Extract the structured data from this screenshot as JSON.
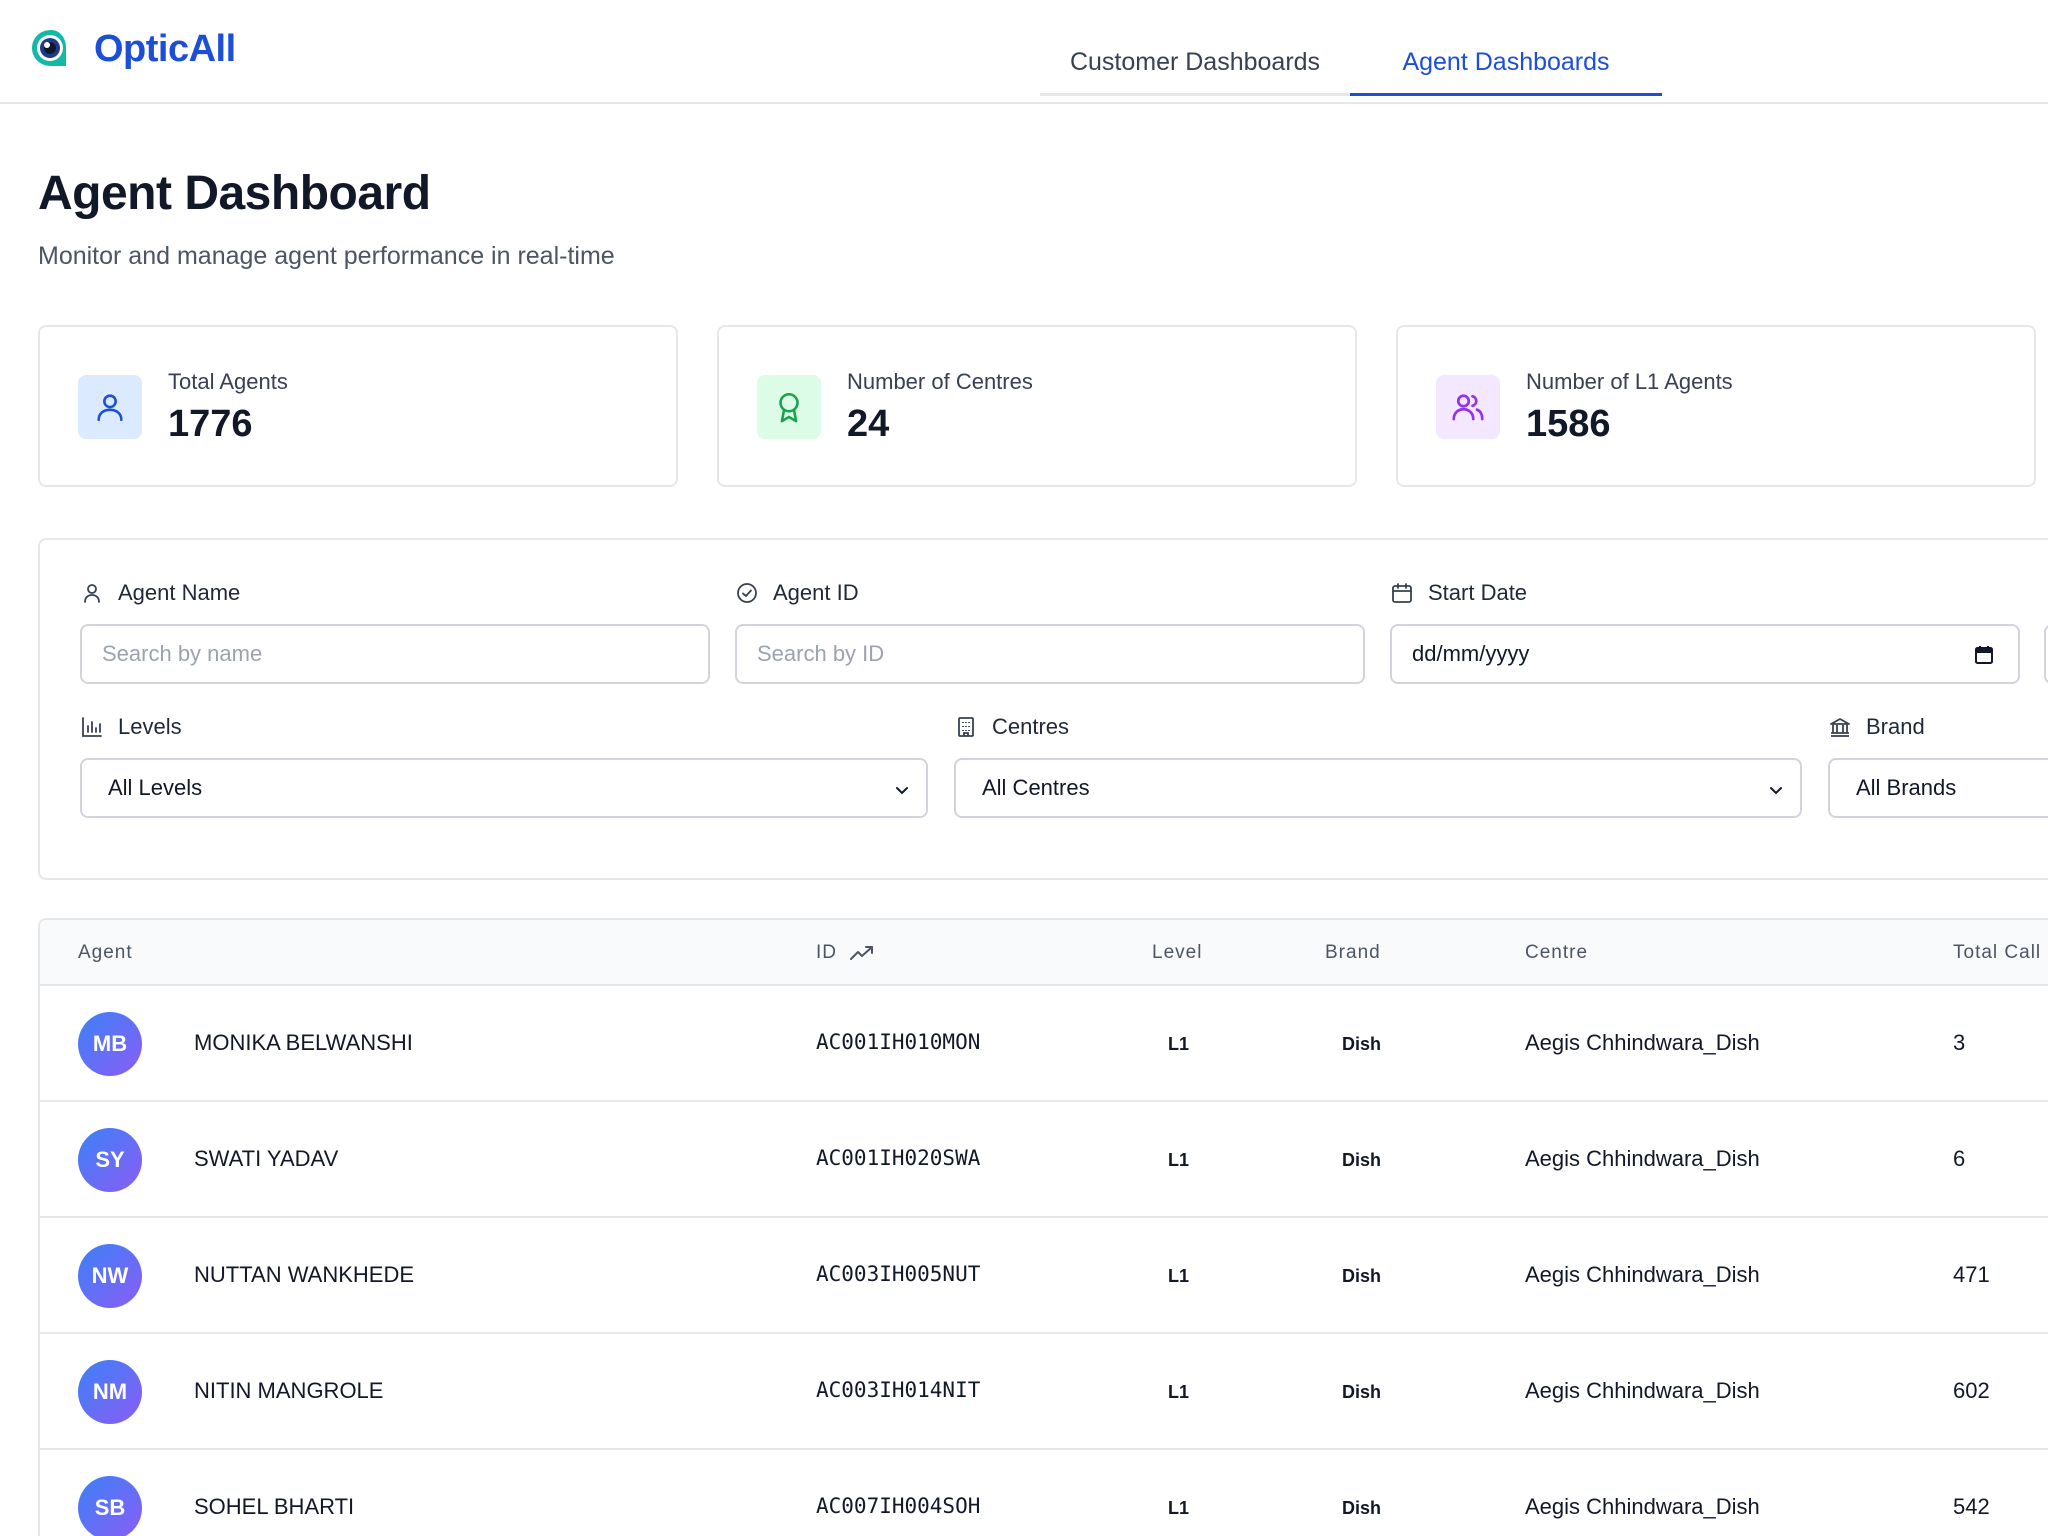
{
  "app": {
    "name": "OpticAll",
    "brand_color": "#1d4ed8"
  },
  "nav": {
    "tabs": [
      {
        "label": "Customer Dashboards",
        "active": false
      },
      {
        "label": "Agent Dashboards",
        "active": true
      }
    ]
  },
  "page": {
    "title": "Agent Dashboard",
    "subtitle": "Monitor and manage agent performance in real-time"
  },
  "stats": [
    {
      "label": "Total Agents",
      "value": "1776",
      "icon": "user-icon",
      "icon_bg": "#dbeafe",
      "icon_color": "#1d4ed8"
    },
    {
      "label": "Number of Centres",
      "value": "24",
      "icon": "award-icon",
      "icon_bg": "#dcfce7",
      "icon_color": "#16a34a"
    },
    {
      "label": "Number of L1 Agents",
      "value": "1586",
      "icon": "users-icon",
      "icon_bg": "#f3e8ff",
      "icon_color": "#9333ea"
    }
  ],
  "filters": {
    "agent_name": {
      "label": "Agent Name",
      "placeholder": "Search by name"
    },
    "agent_id": {
      "label": "Agent ID",
      "placeholder": "Search by ID"
    },
    "start_date": {
      "label": "Start Date",
      "value": "dd/mm/yyyy"
    },
    "levels": {
      "label": "Levels",
      "value": "All Levels"
    },
    "centres": {
      "label": "Centres",
      "value": "All Centres"
    },
    "brand": {
      "label": "Brand",
      "value": "All Brands"
    }
  },
  "table": {
    "columns": [
      "Agent",
      "ID",
      "Level",
      "Brand",
      "Centre",
      "Total Call"
    ],
    "rows": [
      {
        "initials": "MB",
        "name": "MONIKA BELWANSHI",
        "id": "AC001IH010MON",
        "level": "L1",
        "brand": "Dish",
        "centre": "Aegis Chhindwara_Dish",
        "total_calls": "3"
      },
      {
        "initials": "SY",
        "name": "SWATI YADAV",
        "id": "AC001IH020SWA",
        "level": "L1",
        "brand": "Dish",
        "centre": "Aegis Chhindwara_Dish",
        "total_calls": "6"
      },
      {
        "initials": "NW",
        "name": "NUTTAN WANKHEDE",
        "id": "AC003IH005NUT",
        "level": "L1",
        "brand": "Dish",
        "centre": "Aegis Chhindwara_Dish",
        "total_calls": "471"
      },
      {
        "initials": "NM",
        "name": "NITIN MANGROLE",
        "id": "AC003IH014NIT",
        "level": "L1",
        "brand": "Dish",
        "centre": "Aegis Chhindwara_Dish",
        "total_calls": "602"
      },
      {
        "initials": "SB",
        "name": "SOHEL BHARTI",
        "id": "AC007IH004SOH",
        "level": "L1",
        "brand": "Dish",
        "centre": "Aegis Chhindwara_Dish",
        "total_calls": "542"
      }
    ]
  }
}
